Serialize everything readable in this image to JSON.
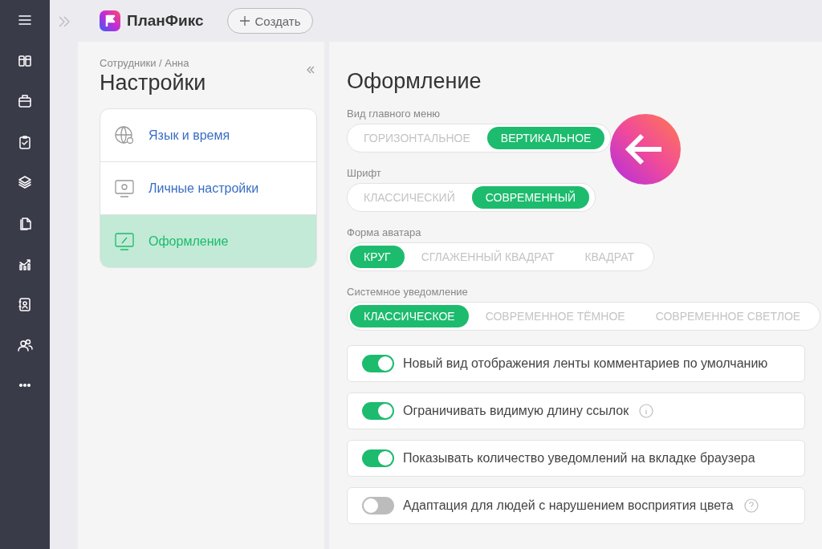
{
  "header": {
    "logo_text": "ПланФикс",
    "create_button": "Создать"
  },
  "settings_nav": {
    "breadcrumb": "Сотрудники / Анна",
    "title": "Настройки",
    "items": [
      {
        "label": "Язык и время",
        "selected": false
      },
      {
        "label": "Личные настройки",
        "selected": false
      },
      {
        "label": "Оформление",
        "selected": true
      }
    ]
  },
  "content": {
    "title": "Оформление",
    "groups": [
      {
        "label": "Вид главного меню",
        "options": [
          {
            "label": "ГОРИЗОНТАЛЬНОЕ",
            "selected": false
          },
          {
            "label": "ВЕРТИКАЛЬНОЕ",
            "selected": true
          }
        ]
      },
      {
        "label": "Шрифт",
        "options": [
          {
            "label": "КЛАССИЧЕСКИЙ",
            "selected": false
          },
          {
            "label": "СОВРЕМЕННЫЙ",
            "selected": true
          }
        ]
      },
      {
        "label": "Форма аватара",
        "options": [
          {
            "label": "КРУГ",
            "selected": true
          },
          {
            "label": "СГЛАЖЕННЫЙ КВАДРАТ",
            "selected": false
          },
          {
            "label": "КВАДРАТ",
            "selected": false
          }
        ]
      },
      {
        "label": "Системное уведомление",
        "options": [
          {
            "label": "КЛАССИЧЕСКОЕ",
            "selected": true
          },
          {
            "label": "СОВРЕМЕННОЕ ТЁМНОЕ",
            "selected": false
          },
          {
            "label": "СОВРЕМЕННОЕ СВЕТЛОЕ",
            "selected": false
          }
        ]
      }
    ],
    "toggles": [
      {
        "label": "Новый вид отображения ленты комментариев по умолчанию",
        "on": true,
        "kind": "plain"
      },
      {
        "label": "Ограничивать видимую длину ссылок",
        "on": true,
        "kind": "info"
      },
      {
        "label": "Показывать количество уведомлений на вкладке браузера",
        "on": true,
        "kind": "plain"
      },
      {
        "label": "Адаптация для людей с нарушением восприятия цвета",
        "on": false,
        "kind": "help"
      }
    ]
  }
}
